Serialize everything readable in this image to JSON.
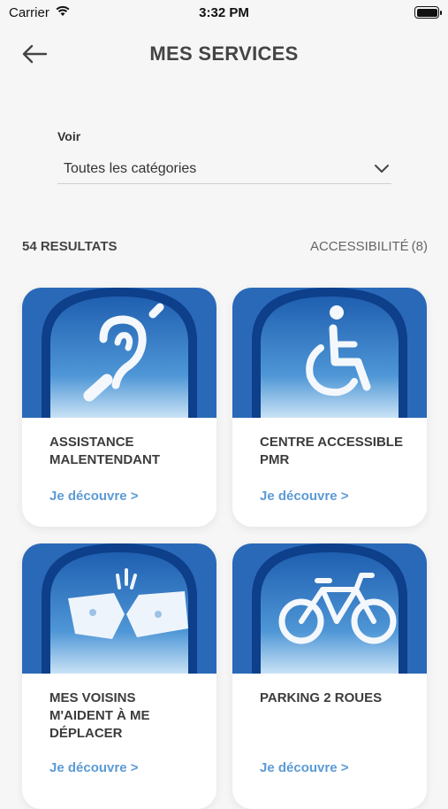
{
  "status": {
    "carrier": "Carrier",
    "time": "3:32 PM"
  },
  "header": {
    "title": "MES SERVICES"
  },
  "filter": {
    "label": "Voir",
    "value": "Toutes les catégories"
  },
  "results": {
    "count_label": "54 RESULTATS",
    "category": "ACCESSIBILITÉ",
    "category_count": "(8)"
  },
  "cards": [
    {
      "title": "ASSISTANCE MALENTENDANT",
      "link": "Je découvre >",
      "icon": "hearing-assistance-icon"
    },
    {
      "title": "CENTRE ACCESSIBLE PMR",
      "link": "Je découvre >",
      "icon": "wheelchair-icon"
    },
    {
      "title": "MES VOISINS M'AIDENT À ME DÉPLACER",
      "link": "Je découvre >",
      "icon": "helping-hands-icon"
    },
    {
      "title": "PARKING 2 ROUES",
      "link": "Je découvre >",
      "icon": "bicycle-icon"
    }
  ],
  "colors": {
    "accent": "#5b9bd5",
    "sky_top": "#1f5fb0",
    "sky_bottom": "#c9e2f5",
    "arch": "#0d3f8a"
  }
}
